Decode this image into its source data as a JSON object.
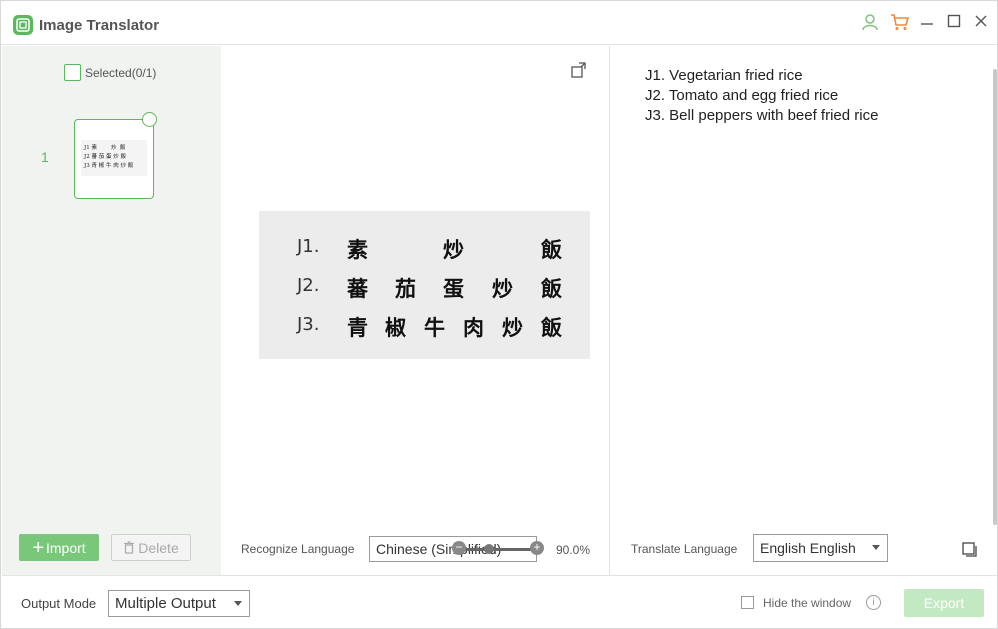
{
  "app": {
    "title": "Image Translator",
    "accent_color": "#5cb85c",
    "icons": [
      "user-icon",
      "cart-icon",
      "minimize-icon",
      "maximize-icon",
      "close-icon"
    ]
  },
  "left": {
    "select_label": "Selected(0/1)",
    "thumbnail_index": "1",
    "thumbnail_text": "J1 素        炒  飯\nJ2 蕃 茄 蛋 炒 飯\nJ3 青 椒 牛 肉 炒 飯",
    "import_label": "Import",
    "delete_label": "Delete"
  },
  "center": {
    "rows": [
      {
        "code": "J1.",
        "chars": [
          "素",
          "",
          "炒",
          "",
          "飯"
        ]
      },
      {
        "code": "J2.",
        "chars": [
          "蕃",
          "茄",
          "蛋",
          "炒",
          "飯"
        ]
      },
      {
        "code": "J3.",
        "chars": [
          "青",
          "椒",
          "牛",
          "肉",
          "炒",
          "飯"
        ]
      }
    ],
    "recognize_label": "Recognize Language",
    "recognize_value": "Chinese (Simplified)",
    "zoom_value": "90.0%"
  },
  "right": {
    "lines": [
      "J1. Vegetarian fried rice",
      "J2. Tomato and egg fried rice",
      "J3. Bell peppers with beef fried rice"
    ],
    "translate_label": "Translate Language",
    "translate_value": "English English"
  },
  "bottom": {
    "output_label": "Output Mode",
    "output_value": "Multiple Output",
    "hide_label": "Hide the window",
    "export_label": "Export"
  }
}
